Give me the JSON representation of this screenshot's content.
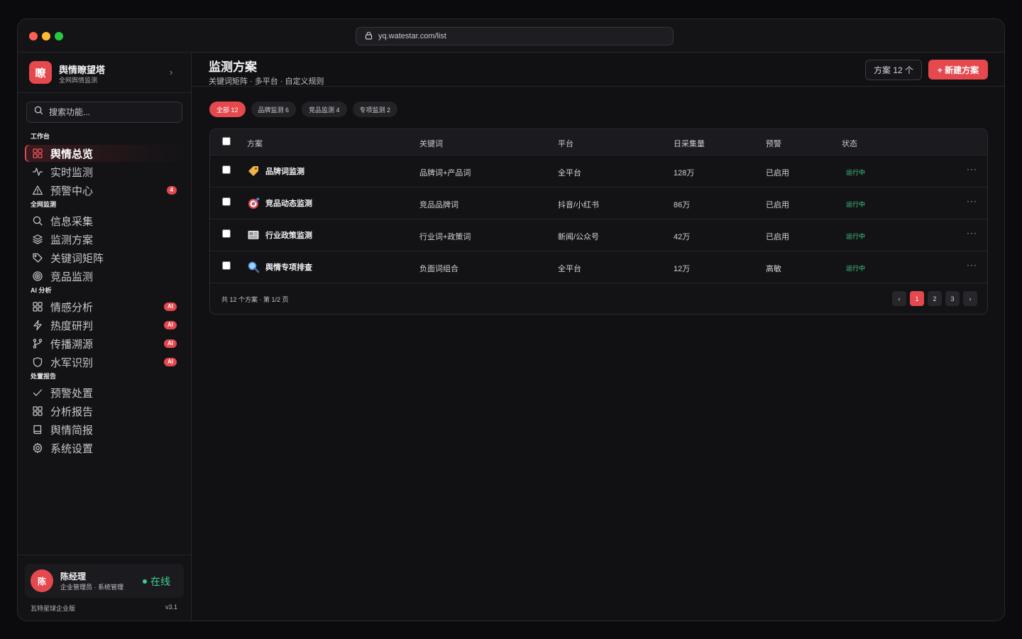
{
  "browser": {
    "url": "yq.watestar.com/list"
  },
  "brand": {
    "logo_char": "瞭",
    "name": "舆情瞭望塔",
    "subtitle": "全网舆情监测"
  },
  "search": {
    "placeholder": "搜索功能..."
  },
  "sidebar": {
    "groups": [
      {
        "label": "工作台",
        "items": [
          {
            "label": "舆情总览",
            "icon": "grid-icon",
            "active": true
          },
          {
            "label": "实时监测",
            "icon": "activity-icon"
          },
          {
            "label": "预警中心",
            "icon": "alert-triangle-icon",
            "badge": "4"
          }
        ]
      },
      {
        "label": "全网监测",
        "items": [
          {
            "label": "信息采集",
            "icon": "search-icon"
          },
          {
            "label": "监测方案",
            "icon": "layers-icon"
          },
          {
            "label": "关键词矩阵",
            "icon": "tag-icon"
          },
          {
            "label": "竞品监测",
            "icon": "target-icon"
          }
        ]
      },
      {
        "label": "AI 分析",
        "items": [
          {
            "label": "情感分析",
            "icon": "grid-icon",
            "badge": "AI"
          },
          {
            "label": "热度研判",
            "icon": "zap-icon",
            "badge": "AI"
          },
          {
            "label": "传播溯源",
            "icon": "git-branch-icon",
            "badge": "AI"
          },
          {
            "label": "水军识别",
            "icon": "shield-icon",
            "badge": "AI"
          }
        ]
      },
      {
        "label": "处置报告",
        "items": [
          {
            "label": "预警处置",
            "icon": "check-icon"
          },
          {
            "label": "分析报告",
            "icon": "grid-icon"
          },
          {
            "label": "舆情简报",
            "icon": "book-icon"
          },
          {
            "label": "系统设置",
            "icon": "gear-icon"
          }
        ]
      }
    ]
  },
  "user": {
    "avatar_char": "陈",
    "name": "陈经理",
    "role": "企业管理员 · 系统管理",
    "status": "在线"
  },
  "footer": {
    "edition": "瓦特星球企业版",
    "version": "v3.1"
  },
  "page": {
    "title": "监测方案",
    "subtitle": "关键词矩阵 · 多平台 · 自定义规则",
    "count_label": "方案 12 个",
    "new_button": "+ 新建方案"
  },
  "filters": [
    {
      "label": "全部 12",
      "active": true
    },
    {
      "label": "品牌监测 6"
    },
    {
      "label": "竞品监测 4"
    },
    {
      "label": "专项监测 2"
    }
  ],
  "table": {
    "columns": [
      "方案",
      "关键词",
      "平台",
      "日采集量",
      "预警",
      "状态"
    ],
    "rows": [
      {
        "icon": "tag-emoji",
        "name": "品牌词监测",
        "keywords": "品牌词+产品词",
        "platform": "全平台",
        "daily": "128万",
        "alert": "已启用",
        "status": "运行中"
      },
      {
        "icon": "target-emoji",
        "name": "竞品动态监测",
        "keywords": "竞品品牌词",
        "platform": "抖音/小红书",
        "daily": "86万",
        "alert": "已启用",
        "status": "运行中"
      },
      {
        "icon": "newspaper-emoji",
        "name": "行业政策监测",
        "keywords": "行业词+政策词",
        "platform": "新闻/公众号",
        "daily": "42万",
        "alert": "已启用",
        "status": "运行中"
      },
      {
        "icon": "magnifier-emoji",
        "name": "舆情专项排查",
        "keywords": "负面词组合",
        "platform": "全平台",
        "daily": "12万",
        "alert": "高敏",
        "status": "运行中"
      }
    ],
    "more_label": "···",
    "footer_text": "共 12 个方案 · 第 1/2 页"
  },
  "pagination": {
    "prev": "‹",
    "pages": [
      "1",
      "2",
      "3"
    ],
    "next": "›",
    "current": "1"
  },
  "colors": {
    "accent": "#e5484d",
    "success": "#3ecf8e",
    "background": "#111114"
  }
}
